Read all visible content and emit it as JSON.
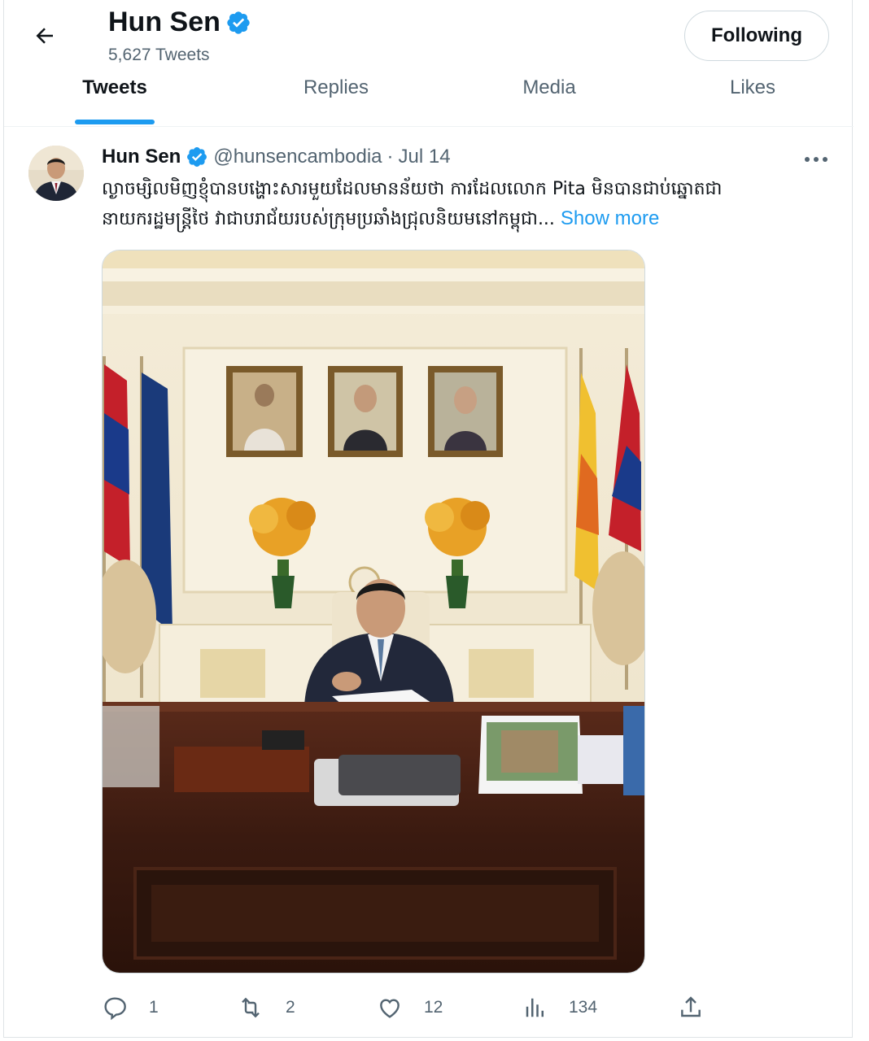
{
  "header": {
    "name": "Hun Sen",
    "tweet_count": "5,627 Tweets",
    "follow_label": "Following"
  },
  "tabs": [
    {
      "label": "Tweets",
      "active": true
    },
    {
      "label": "Replies",
      "active": false
    },
    {
      "label": "Media",
      "active": false
    },
    {
      "label": "Likes",
      "active": false
    }
  ],
  "tweet": {
    "author_name": "Hun Sen",
    "handle": "@hunsencambodia",
    "separator": "·",
    "date": "Jul 14",
    "text_line1": "ល្ងាចម្សិលមិញខ្ញុំបានបង្ហោះសារមួយដែលមានន័យថា ការដែលលោក Pita មិនបានជាប់ឆ្នោតជា",
    "text_line2": "នាយករដ្ឋមន្ត្រីថៃ វាជាបរាជ័យរបស់ក្រុមប្រឆាំងជ្រុលនិយមនៅកម្ពុជា...",
    "show_more": "Show more",
    "replies": "1",
    "retweets": "2",
    "likes": "12",
    "views": "134"
  },
  "colors": {
    "accent": "#1d9bf0",
    "text_primary": "#0f1419",
    "text_secondary": "#536471",
    "border": "#cfd9de"
  },
  "icons": {
    "back": "arrow-left-icon",
    "verified": "verified-badge-icon",
    "more": "more-horizontal-icon",
    "reply": "reply-icon",
    "retweet": "retweet-icon",
    "like": "heart-icon",
    "views": "views-icon",
    "share": "share-icon"
  }
}
